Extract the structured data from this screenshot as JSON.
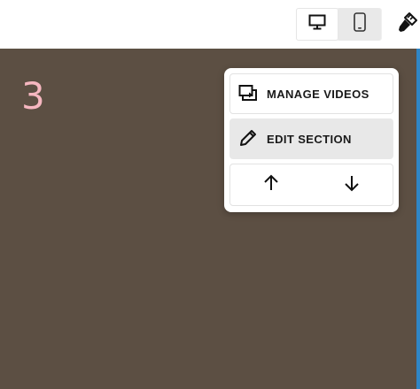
{
  "toolbar": {
    "device_desktop_icon": "desktop-icon",
    "device_mobile_icon": "mobile-icon",
    "style_icon": "paintbrush-icon"
  },
  "canvas": {
    "background_color": "#5c4f43",
    "section_number": "3",
    "section_number_color": "#f6b7c0"
  },
  "section_menu": {
    "manage_videos_label": "MANAGE VIDEOS",
    "manage_videos_icon": "video-library-icon",
    "edit_section_label": "EDIT SECTION",
    "edit_section_icon": "pencil-icon",
    "move_up_icon": "arrow-up-icon",
    "move_down_icon": "arrow-down-icon"
  }
}
